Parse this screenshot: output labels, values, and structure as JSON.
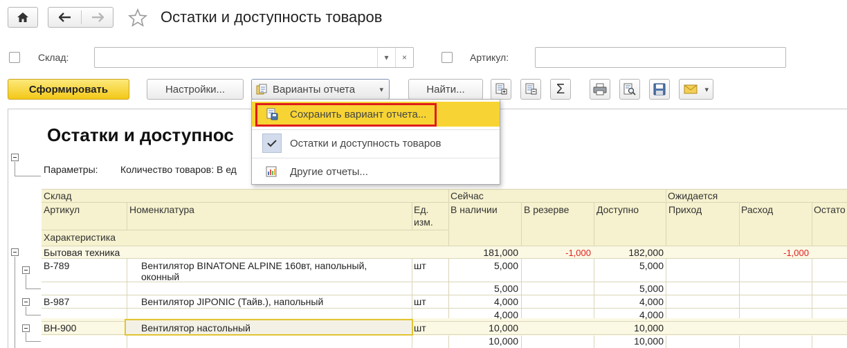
{
  "window": {
    "title": "Остатки и доступность товаров"
  },
  "filters": {
    "warehouse_label": "Склад:",
    "warehouse_value": "",
    "dropdown_glyph": "▾",
    "clear_glyph": "×",
    "article_label": "Артикул:",
    "article_value": ""
  },
  "toolbar": {
    "generate": "Сформировать",
    "settings": "Настройки...",
    "variants": "Варианты отчета",
    "find": "Найти...",
    "sum_glyph": "Σ"
  },
  "menu": {
    "items": [
      {
        "label": "Сохранить вариант отчета..."
      },
      {
        "label": "Остатки и доступность товаров"
      },
      {
        "label": "Другие отчеты..."
      }
    ]
  },
  "report": {
    "title": "Остатки и доступнос",
    "params_label": "Параметры:",
    "params_value": "Количество товаров: В ед",
    "headers": {
      "warehouse": "Склад",
      "now": "Сейчас",
      "expected": "Ожидается",
      "article": "Артикул",
      "nomenclature": "Номенклатура",
      "unit_line1": "Ед.",
      "unit_line2": "изм.",
      "in_stock": "В наличии",
      "reserved": "В резерве",
      "available": "Доступно",
      "incoming": "Приход",
      "outgoing": "Расход",
      "remainder": "Остато",
      "characteristic": "Характеристика"
    },
    "rows": [
      {
        "article": "Бытовая техника",
        "name": "",
        "unit": "",
        "in_stock": "181,000",
        "reserved": "-1,000",
        "available": "182,000",
        "incoming": "",
        "outgoing": "-1,000"
      },
      {
        "article": "В-789",
        "name": "Вентилятор BINATONE ALPINE 160вт, напольный,",
        "name2": "оконный",
        "unit": "шт",
        "in_stock": "5,000",
        "reserved": "",
        "available": "5,000",
        "incoming": "",
        "outgoing": ""
      },
      {
        "article": "",
        "name": "",
        "unit": "",
        "in_stock": "5,000",
        "reserved": "",
        "available": "5,000",
        "incoming": "",
        "outgoing": ""
      },
      {
        "article": "В-987",
        "name": "Вентилятор JIPONIC (Тайв.), напольный",
        "unit": "шт",
        "in_stock": "4,000",
        "reserved": "",
        "available": "4,000",
        "incoming": "",
        "outgoing": ""
      },
      {
        "article": "",
        "name": "",
        "unit": "",
        "in_stock": "4,000",
        "reserved": "",
        "available": "4,000",
        "incoming": "",
        "outgoing": ""
      },
      {
        "article": "ВН-900",
        "name": "Вентилятор настольный",
        "unit": "шт",
        "in_stock": "10,000",
        "reserved": "",
        "available": "10,000",
        "incoming": "",
        "outgoing": ""
      },
      {
        "article": "",
        "name": "",
        "unit": "",
        "in_stock": "10,000",
        "reserved": "",
        "available": "10,000",
        "incoming": "",
        "outgoing": ""
      }
    ]
  },
  "colors": {
    "accent_yellow": "#f3c818",
    "menu_highlight": "#f7d434",
    "highlight_border": "#e01b1b",
    "header_bg": "#f6f2cf",
    "negative": "#e02020"
  }
}
